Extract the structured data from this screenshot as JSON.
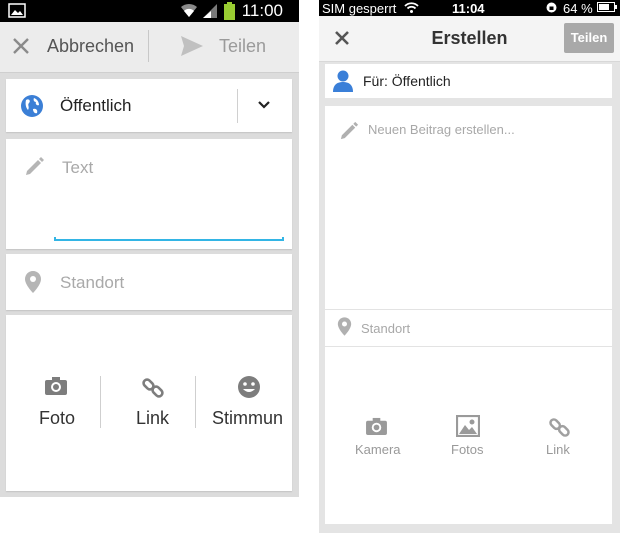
{
  "android": {
    "status": {
      "time": "11:00"
    },
    "actionbar": {
      "cancel_label": "Abbrechen",
      "share_label": "Teilen"
    },
    "audience": {
      "label": "Öffentlich"
    },
    "text": {
      "placeholder": "Text"
    },
    "location": {
      "placeholder": "Standort"
    },
    "media": {
      "photo_label": "Foto",
      "link_label": "Link",
      "mood_label": "Stimmun"
    },
    "colors": {
      "accent": "#33b5e5",
      "globe": "#3b7fd6"
    }
  },
  "ios": {
    "status": {
      "carrier": "SIM gesperrt",
      "time": "11:04",
      "battery": "64 %"
    },
    "nav": {
      "title": "Erstellen",
      "share_label": "Teilen"
    },
    "audience": {
      "label": "Für: Öffentlich"
    },
    "post": {
      "placeholder": "Neuen Beitrag erstellen..."
    },
    "location": {
      "placeholder": "Standort"
    },
    "media": {
      "camera_label": "Kamera",
      "photos_label": "Fotos",
      "link_label": "Link"
    },
    "colors": {
      "person": "#3a7fd8"
    }
  },
  "icons": [
    "image-icon",
    "wifi-icon",
    "signal-icon",
    "battery-icon",
    "close-icon",
    "send-icon",
    "globe-icon",
    "chevron-down-icon",
    "pencil-icon",
    "location-pin-icon",
    "camera-icon",
    "link-icon",
    "smiley-icon",
    "person-icon",
    "photos-icon"
  ]
}
